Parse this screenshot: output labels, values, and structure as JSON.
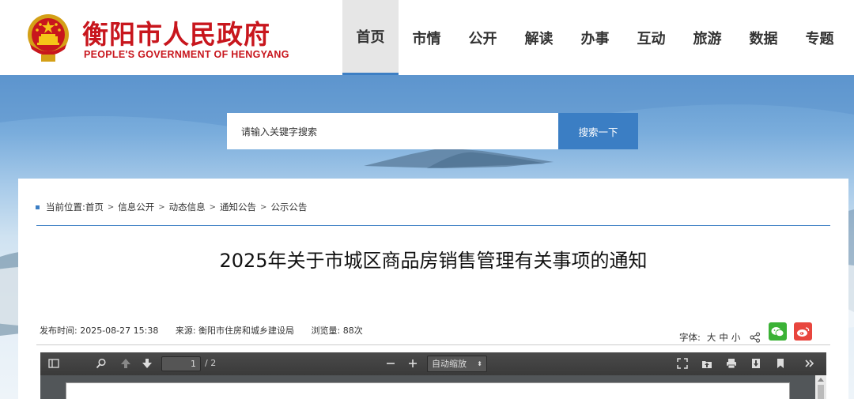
{
  "header": {
    "site_title": "衡阳市人民政府",
    "site_subtitle": "PEOPLE'S GOVERNMENT OF HENGYANG",
    "nav": [
      "首页",
      "市情",
      "公开",
      "解读",
      "办事",
      "互动",
      "旅游",
      "数据",
      "专题"
    ],
    "active_nav": "首页"
  },
  "search": {
    "placeholder": "请输入关键字搜索",
    "button_label": "搜索一下"
  },
  "breadcrumb": {
    "prefix": "当前位置:",
    "items": [
      "首页",
      "信息公开",
      "动态信息",
      "通知公告",
      "公示公告"
    ]
  },
  "article": {
    "title": "2025年关于市城区商品房销售管理有关事项的通知",
    "publish_time": "发布时间:  2025-08-27 15:38",
    "source": "来源:  衡阳市住房和城乡建设局",
    "views": "浏览量:  88次",
    "font_label": "字体:",
    "font_sizes": [
      "大",
      "中",
      "小"
    ]
  },
  "pdf": {
    "page_current": "1",
    "page_total": "/ 2",
    "zoom_label": "自动缩放"
  },
  "colors": {
    "brand_red": "#c8161d",
    "accent_blue": "#3b7ec4",
    "toolbar_dark": "#3a3a3a"
  }
}
